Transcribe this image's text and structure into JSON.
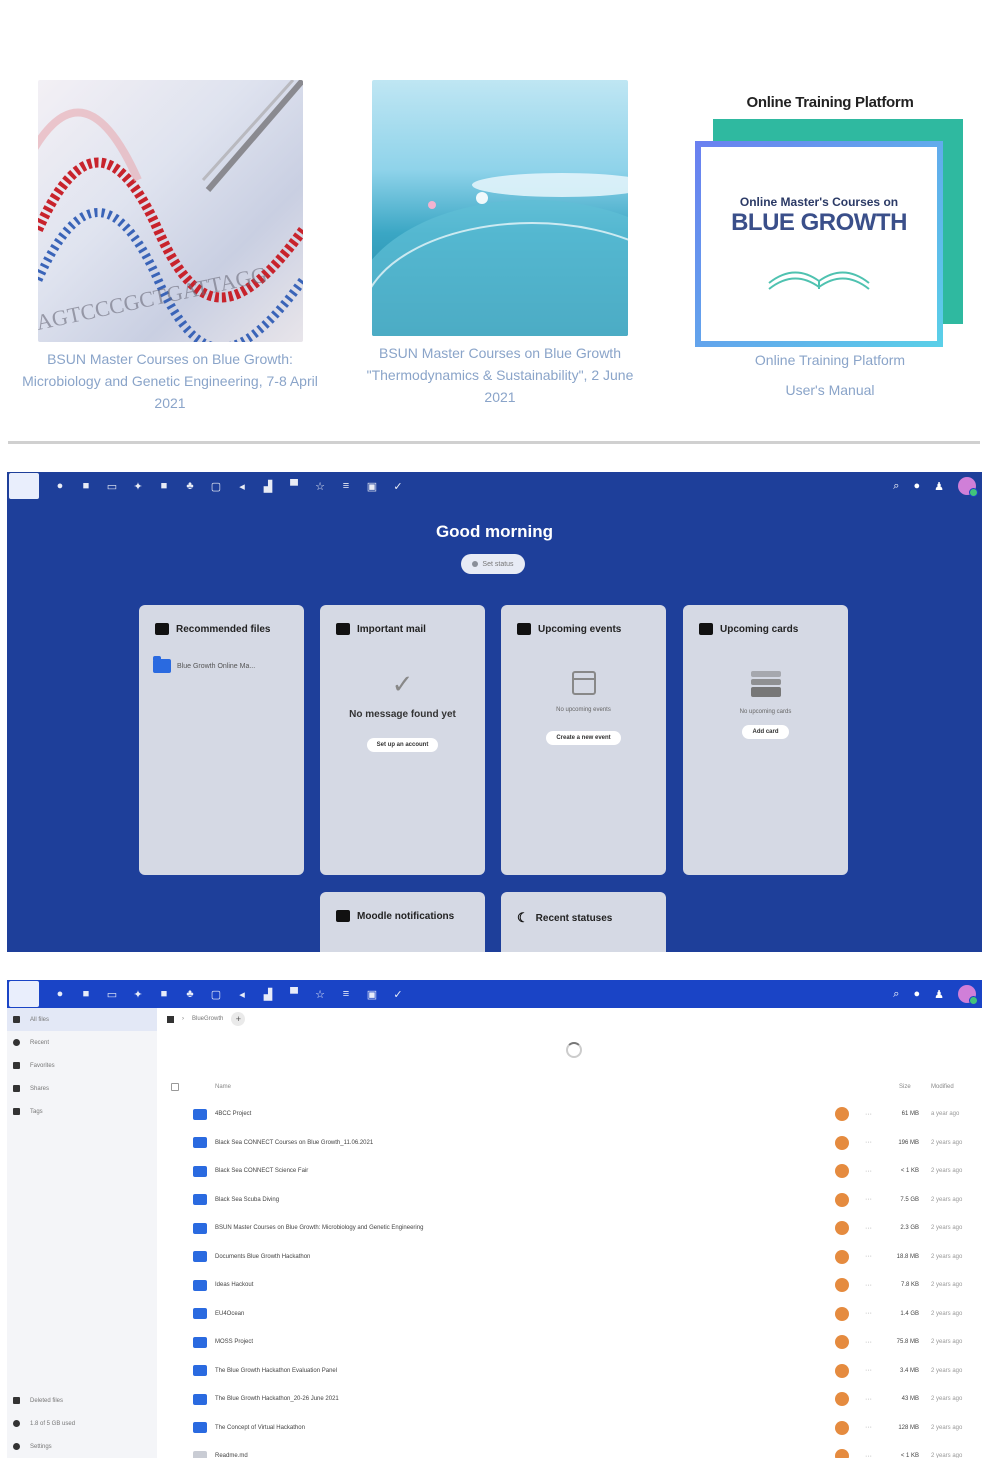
{
  "courses": [
    {
      "caption_lines": [
        "BSUN Master Courses on Blue Growth:",
        "Microbiology and Genetic Engineering, 7-8 April",
        "2021"
      ]
    },
    {
      "caption_lines": [
        "BSUN Master Courses on Blue Growth",
        "\"Thermodynamics & Sustainability\", 2 June 2021"
      ]
    },
    {
      "title": "Online Training Platform",
      "banner_small": "Online Master's Courses on",
      "banner_big": "BLUE GROWTH",
      "caption_lines": [
        "Online Training Platform",
        "User's Manual"
      ]
    }
  ],
  "dashboard": {
    "greeting": "Good morning",
    "status_button": "Set status",
    "panels": {
      "recommended": {
        "title": "Recommended files",
        "file": "Blue Growth Online Ma..."
      },
      "mail": {
        "title": "Important mail",
        "empty": "No message found yet",
        "action": "Set up an account"
      },
      "events": {
        "title": "Upcoming events",
        "empty": "No upcoming events",
        "action": "Create a new event"
      },
      "cards": {
        "title": "Upcoming cards",
        "empty": "No upcoming cards",
        "action": "Add card"
      },
      "moodle": {
        "title": "Moodle notifications"
      },
      "statuses": {
        "title": "Recent statuses"
      }
    }
  },
  "files": {
    "sidebar": [
      "All files",
      "Recent",
      "Favorites",
      "Shares",
      "Tags"
    ],
    "sidebar_bottom": [
      "Deleted files",
      "1.8 of 5 GB used",
      "Settings"
    ],
    "breadcrumb": "BlueGrowth",
    "columns": {
      "name": "Name",
      "size": "Size",
      "modified": "Modified"
    },
    "rows": [
      {
        "name": "4BCC Project",
        "size": "61 MB",
        "modified": "a year ago"
      },
      {
        "name": "Black Sea CONNECT Courses on Blue Growth_11.06.2021",
        "size": "196 MB",
        "modified": "2 years ago"
      },
      {
        "name": "Black Sea CONNECT Science Fair",
        "size": "< 1 KB",
        "modified": "2 years ago"
      },
      {
        "name": "Black Sea Scuba Diving",
        "size": "7.5 GB",
        "modified": "2 years ago"
      },
      {
        "name": "BSUN Master Courses on Blue Growth: Microbiology and Genetic Engineering",
        "size": "2.3 GB",
        "modified": "2 years ago"
      },
      {
        "name": "Documents Blue Growth Hackathon",
        "size": "18.8 MB",
        "modified": "2 years ago"
      },
      {
        "name": "Ideas Hackout",
        "size": "7.8 KB",
        "modified": "2 years ago"
      },
      {
        "name": "EU4Ocean",
        "size": "1.4 GB",
        "modified": "2 years ago"
      },
      {
        "name": "MOSS Project",
        "size": "75.8 MB",
        "modified": "2 years ago"
      },
      {
        "name": "The Blue Growth Hackathon Evaluation Panel",
        "size": "3.4 MB",
        "modified": "2 years ago"
      },
      {
        "name": "The Blue Growth Hackathon_20-26 June 2021",
        "size": "43 MB",
        "modified": "2 years ago"
      },
      {
        "name": "The Concept of Virtual Hackathon",
        "size": "128 MB",
        "modified": "2 years ago"
      },
      {
        "name": "Readme.md",
        "size": "< 1 KB",
        "modified": "2 years ago"
      }
    ]
  },
  "colors": {
    "brand": "#1a44c6",
    "dashboard_bg": "#1e3f9a",
    "panel_bg": "#d5d9e4",
    "folder": "#2a6ae0",
    "share": "#e58b3f"
  }
}
